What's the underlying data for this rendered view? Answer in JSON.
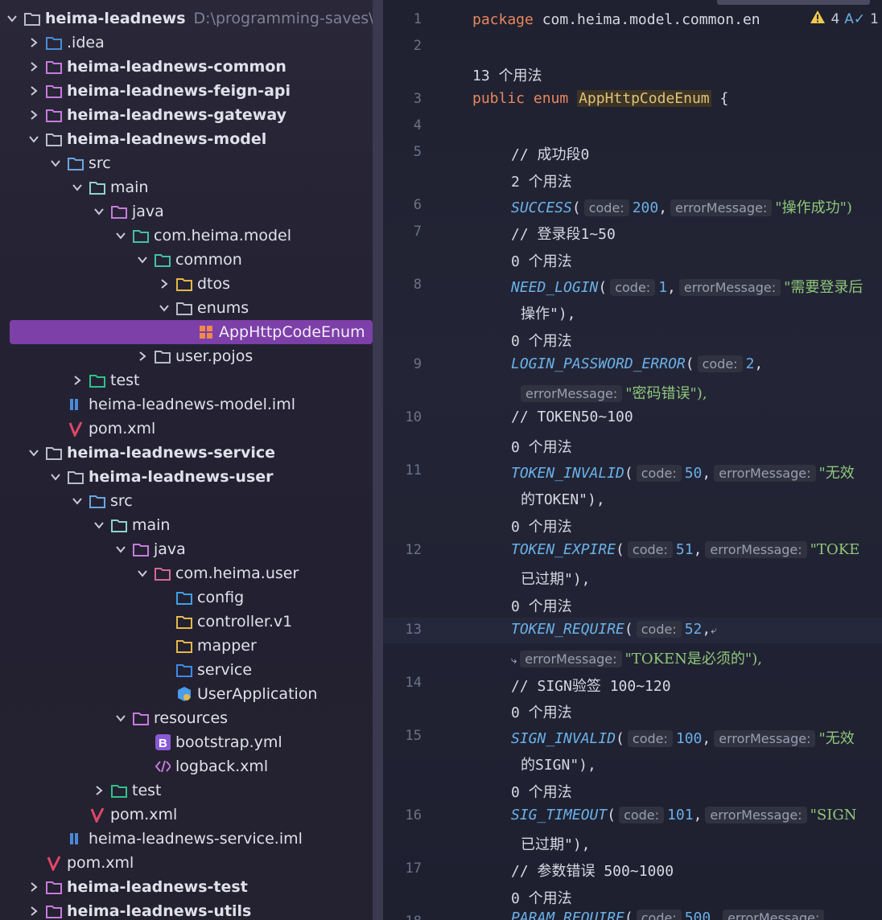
{
  "project_tree": {
    "root_label": "heima-leadnews",
    "root_path": "D:\\programming-saves\\Ja",
    "rows": [
      {
        "label": "heima-leadnews",
        "extra": "D:\\programming-saves\\Ja",
        "icon": "folder-icon",
        "arrow": "down",
        "bold": true
      },
      {
        "label": ".idea",
        "icon": "idea-folder-icon",
        "arrow": "right"
      },
      {
        "label": "heima-leadnews-common",
        "icon": "module-icon",
        "arrow": "right",
        "bold": true
      },
      {
        "label": "heima-leadnews-feign-api",
        "icon": "module-icon",
        "arrow": "right",
        "bold": true
      },
      {
        "label": "heima-leadnews-gateway",
        "icon": "module-icon",
        "arrow": "right",
        "bold": true
      },
      {
        "label": "heima-leadnews-model",
        "icon": "folder-icon",
        "arrow": "down",
        "bold": true
      },
      {
        "label": "src",
        "icon": "source-root-icon",
        "arrow": "down"
      },
      {
        "label": "main",
        "icon": "main-folder-icon",
        "arrow": "down"
      },
      {
        "label": "java",
        "icon": "java-folder-icon",
        "arrow": "down"
      },
      {
        "label": "com.heima.model",
        "icon": "package-icon",
        "arrow": "down"
      },
      {
        "label": "common",
        "icon": "package-icon",
        "arrow": "down"
      },
      {
        "label": "dtos",
        "icon": "yellow-folder-icon",
        "arrow": "right"
      },
      {
        "label": "enums",
        "icon": "enum-folder-icon",
        "arrow": "down"
      },
      {
        "label": "AppHttpCodeEnum",
        "icon": "enum-class-icon",
        "arrow": "none",
        "selected": true
      },
      {
        "label": "user.pojos",
        "icon": "folder-icon",
        "arrow": "right"
      },
      {
        "label": "test",
        "icon": "test-folder-icon",
        "arrow": "right"
      },
      {
        "label": "heima-leadnews-model.iml",
        "icon": "iml-file-icon",
        "arrow": "none"
      },
      {
        "label": "pom.xml",
        "icon": "maven-icon",
        "arrow": "none"
      },
      {
        "label": "heima-leadnews-service",
        "icon": "folder-icon",
        "arrow": "down",
        "bold": true
      },
      {
        "label": "heima-leadnews-user",
        "icon": "folder-icon",
        "arrow": "down",
        "bold": true
      },
      {
        "label": "src",
        "icon": "source-root-icon",
        "arrow": "down"
      },
      {
        "label": "main",
        "icon": "main-folder-icon",
        "arrow": "down"
      },
      {
        "label": "java",
        "icon": "java-folder-icon",
        "arrow": "down"
      },
      {
        "label": "com.heima.user",
        "icon": "user-package-icon",
        "arrow": "down"
      },
      {
        "label": "config",
        "icon": "config-folder-icon",
        "arrow": "none"
      },
      {
        "label": "controller.v1",
        "icon": "yellow-folder-icon",
        "arrow": "none"
      },
      {
        "label": "mapper",
        "icon": "mapper-folder-icon",
        "arrow": "none"
      },
      {
        "label": "service",
        "icon": "service-folder-icon",
        "arrow": "none"
      },
      {
        "label": "UserApplication",
        "icon": "spring-app-icon",
        "arrow": "none"
      },
      {
        "label": "resources",
        "icon": "resources-folder-icon",
        "arrow": "down"
      },
      {
        "label": "bootstrap.yml",
        "icon": "bootstrap-icon",
        "arrow": "none"
      },
      {
        "label": "logback.xml",
        "icon": "xml-icon",
        "arrow": "none"
      },
      {
        "label": "test",
        "icon": "test-folder-icon",
        "arrow": "right"
      },
      {
        "label": "pom.xml",
        "icon": "maven-icon",
        "arrow": "none"
      },
      {
        "label": "heima-leadnews-service.iml",
        "icon": "iml-file-icon",
        "arrow": "none"
      },
      {
        "label": "pom.xml",
        "icon": "maven-icon",
        "arrow": "none"
      },
      {
        "label": "heima-leadnews-test",
        "icon": "module-icon",
        "arrow": "right",
        "bold": true
      },
      {
        "label": "heima-leadnews-utils",
        "icon": "module-icon",
        "arrow": "right",
        "bold": true
      }
    ]
  },
  "editor": {
    "inspection": {
      "warnings": "4",
      "typos": "1"
    },
    "line_numbers": [
      "1",
      "2",
      "3",
      "4",
      "5",
      "6",
      "7",
      "8",
      "9",
      "10",
      "11",
      "12",
      "13",
      "14",
      "15",
      "16",
      "17",
      "18"
    ],
    "code": {
      "pkg_kw": "package",
      "pkg_name": "com.heima.model.common.en",
      "usages_13": "13 个用法",
      "public_kw": "public",
      "enum_kw": "enum",
      "class_name": "AppHttpCodeEnum",
      "brace": "{",
      "c_success": "// 成功段0",
      "u_2": "2 个用法",
      "u_0": "0 个用法",
      "success": "SUCCESS",
      "success_code": "200",
      "success_msg": "\"操作成功\")",
      "c_login": "// 登录段1~50",
      "need_login": "NEED_LOGIN",
      "need_login_code": "1",
      "need_login_msg": "\"需要登录后",
      "need_login_msg2": "操作\"),",
      "lpe": "LOGIN_PASSWORD_ERROR",
      "lpe_code": "2",
      "lpe_msg": "\"密码错误\"),",
      "c_token": "// TOKEN50~100",
      "ti": "TOKEN_INVALID",
      "ti_code": "50",
      "ti_msg": "\"无效",
      "ti_msg2": "的TOKEN\"),",
      "te": "TOKEN_EXPIRE",
      "te_code": "51",
      "te_msg": "\"TOKE",
      "te_msg2": "已过期\"),",
      "tr": "TOKEN_REQUIRE",
      "tr_code": "52",
      "tr_msg": "\"TOKEN是必须的\"),",
      "c_sign": "// SIGN验签 100~120",
      "si": "SIGN_INVALID",
      "si_code": "100",
      "si_msg": "\"无效",
      "si_msg2": "的SIGN\"),",
      "st": "SIG_TIMEOUT",
      "st_code": "101",
      "st_msg": "\"SIGN",
      "st_msg2": "已过期\"),",
      "c_param": "// 参数错误 500~1000",
      "pr": "PARAM_REQUIRE",
      "pr_code": "500",
      "hint_code": "code:",
      "hint_msg": "errorMessage:"
    }
  }
}
